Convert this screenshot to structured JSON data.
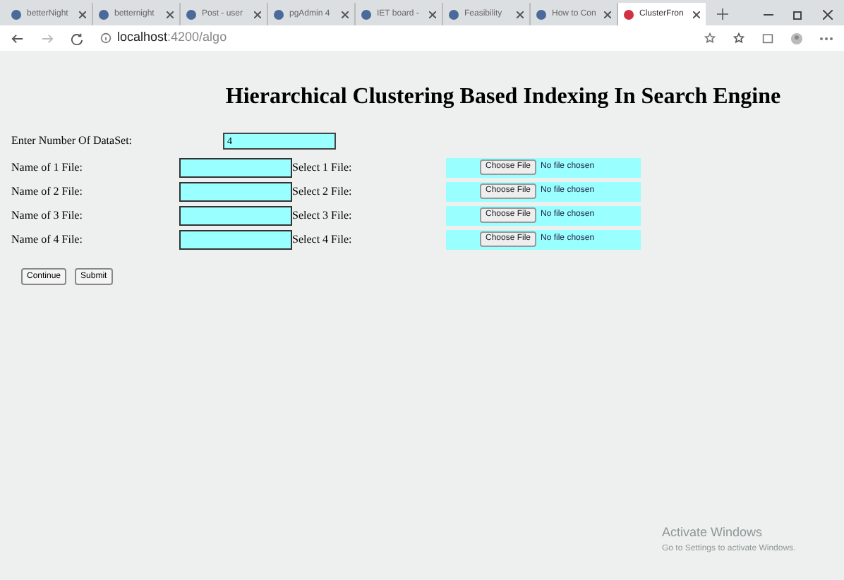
{
  "browser": {
    "tabs": [
      {
        "title": "betterNight",
        "selected": false
      },
      {
        "title": "betternight",
        "selected": false
      },
      {
        "title": "Post - user",
        "selected": false
      },
      {
        "title": "pgAdmin 4",
        "selected": false
      },
      {
        "title": "IET board -",
        "selected": false
      },
      {
        "title": "Feasibility",
        "selected": false
      },
      {
        "title": "How to Con",
        "selected": false
      },
      {
        "title": "ClusterFron",
        "selected": true
      }
    ],
    "address": {
      "host": "localhost",
      "path": ":4200/algo"
    }
  },
  "page": {
    "title": "Hierarchical Clustering Based Indexing In Search Engine",
    "dataset": {
      "label": "Enter Number Of DataSet:",
      "value": "4"
    },
    "files": [
      {
        "name_label": "Name of 1 File:",
        "select_label": "Select 1 File:",
        "button": "Choose File",
        "status": "No file chosen"
      },
      {
        "name_label": "Name of 2 File:",
        "select_label": "Select 2 File:",
        "button": "Choose File",
        "status": "No file chosen"
      },
      {
        "name_label": "Name of 3 File:",
        "select_label": "Select 3 File:",
        "button": "Choose File",
        "status": "No file chosen"
      },
      {
        "name_label": "Name of 4 File:",
        "select_label": "Select 4 File:",
        "button": "Choose File",
        "status": "No file chosen"
      }
    ],
    "buttons": [
      "Continue",
      "Submit"
    ]
  },
  "os_notice": {
    "title": "Activate Windows",
    "text": "Go to Settings to activate Windows."
  }
}
